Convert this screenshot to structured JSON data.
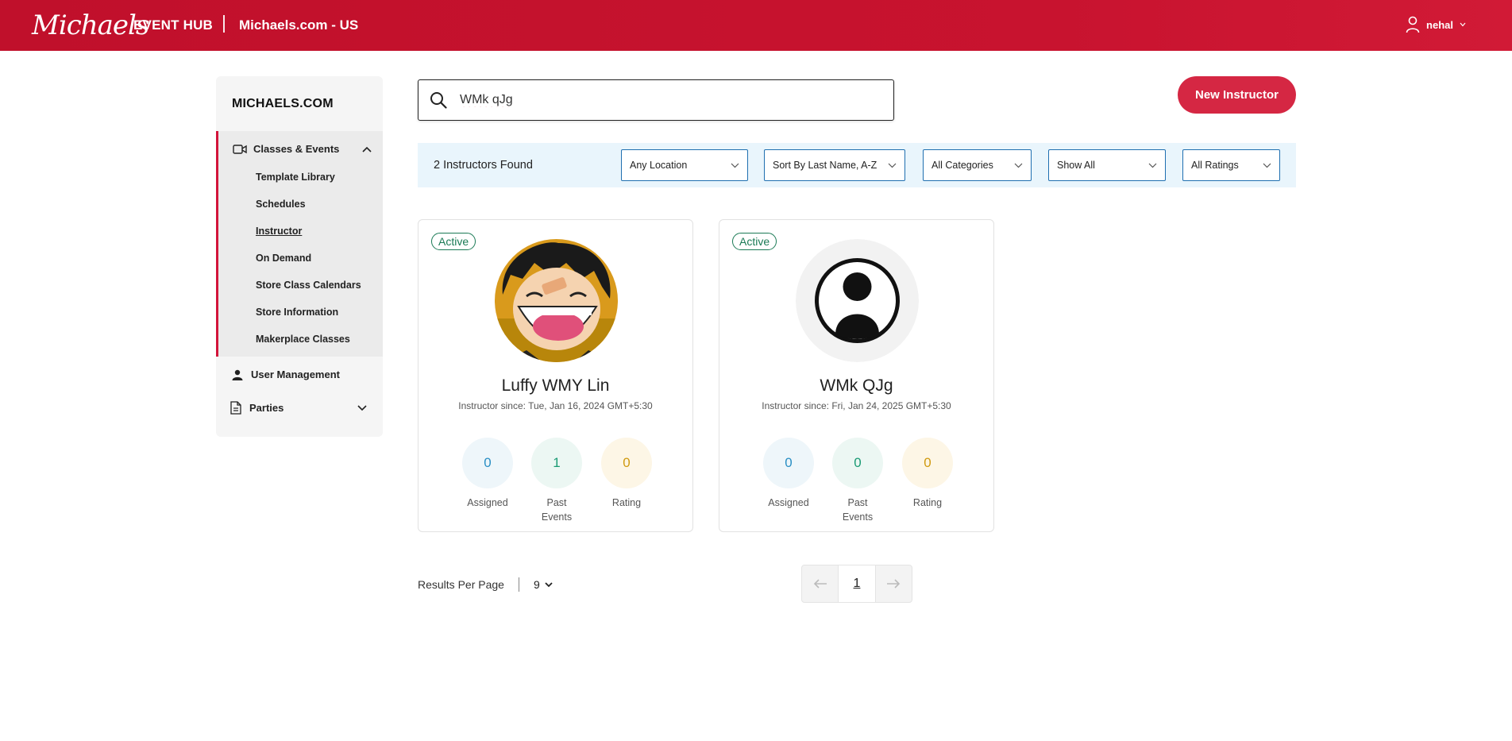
{
  "header": {
    "logo_text": "Michaels",
    "app_name": "EVENT HUB",
    "site_name": "Michaels.com - US",
    "user_name": "nehal"
  },
  "sidebar": {
    "title": "MICHAELS.COM",
    "group": {
      "label": "Classes & Events",
      "items": [
        {
          "label": "Template Library"
        },
        {
          "label": "Schedules"
        },
        {
          "label": "Instructor"
        },
        {
          "label": "On Demand"
        },
        {
          "label": "Store Class Calendars"
        },
        {
          "label": "Store Information"
        },
        {
          "label": "Makerplace Classes"
        }
      ]
    },
    "user_management": "User Management",
    "parties": "Parties"
  },
  "search": {
    "value": "WMk qJg",
    "placeholder": "Search"
  },
  "new_instructor_button": "New Instructor",
  "filters": {
    "found_text": "2 Instructors Found",
    "location": "Any Location",
    "sort": "Sort By Last Name, A-Z",
    "categories": "All Categories",
    "show": "Show All",
    "ratings": "All Ratings"
  },
  "instructors": [
    {
      "status": "Active",
      "name": "Luffy WMY Lin",
      "since_label": "Instructor since:",
      "since_date": "Tue, Jan 16, 2024 GMT+5:30",
      "assigned": "0",
      "past_events": "1",
      "rating": "0"
    },
    {
      "status": "Active",
      "name": "WMk QJg",
      "since_label": "Instructor since:",
      "since_date": "Fri, Jan 24, 2025 GMT+5:30",
      "assigned": "0",
      "past_events": "0",
      "rating": "0"
    }
  ],
  "stat_labels": {
    "assigned": "Assigned",
    "past_line1": "Past",
    "past_line2": "Events",
    "rating": "Rating"
  },
  "pagination": {
    "results_per_page_label": "Results Per Page",
    "per_page": "9",
    "current_page": "1"
  },
  "colors": {
    "brand_red": "#c8132f",
    "button_red": "#d52743",
    "active_green": "#1a7a55",
    "filter_bg": "#e9f5fc"
  }
}
